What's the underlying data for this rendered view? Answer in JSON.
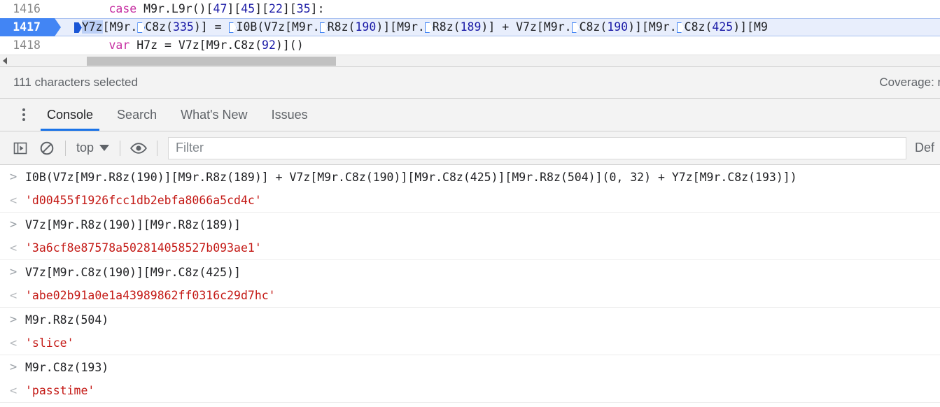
{
  "editor": {
    "lines": [
      {
        "number": "1416",
        "active": false,
        "text": "        case M9r.L9r()[47][45][22][35]:"
      },
      {
        "number": "1417",
        "active": true,
        "text": "            Y7z[M9r.C8z(335)] = I0B(V7z[M9r.R8z(190)][M9r.R8z(189)] + V7z[M9r.C8z(190)][M9r.C8z(425)][M9"
      },
      {
        "number": "1418",
        "active": false,
        "text": "            var H7z = V7z[M9r.C8z(92)]()"
      }
    ],
    "scrollbar": {
      "name": "horizontal-scrollbar"
    }
  },
  "status_bar": {
    "selection_text": "111 characters selected",
    "coverage_text": "Coverage: n"
  },
  "drawer": {
    "more_label": "More tools",
    "tabs": [
      {
        "label": "Console",
        "active": true
      },
      {
        "label": "Search",
        "active": false
      },
      {
        "label": "What's New",
        "active": false
      },
      {
        "label": "Issues",
        "active": false
      }
    ]
  },
  "toolbar": {
    "sidebar_toggle": "show-console-sidebar",
    "clear_console": "clear-console",
    "context_label": "top",
    "eye_label": "live-expressions",
    "filter_placeholder": "Filter",
    "levels_label": "Def"
  },
  "console": {
    "entries": [
      {
        "type": "command",
        "text": "I0B(V7z[M9r.R8z(190)][M9r.R8z(189)] + V7z[M9r.C8z(190)][M9r.C8z(425)][M9r.R8z(504)](0, 32) + Y7z[M9r.C8z(193)])"
      },
      {
        "type": "result",
        "text": "'d00455f1926fcc1db2ebfa8066a5cd4c'"
      },
      {
        "type": "command",
        "text": "V7z[M9r.R8z(190)][M9r.R8z(189)]"
      },
      {
        "type": "result",
        "text": "'3a6cf8e87578a502814058527b093ae1'"
      },
      {
        "type": "command",
        "text": "V7z[M9r.C8z(190)][M9r.C8z(425)]"
      },
      {
        "type": "result",
        "text": "'abe02b91a0e1a43989862ff0316c29d7hc'"
      },
      {
        "type": "command",
        "text": "M9r.R8z(504)"
      },
      {
        "type": "result",
        "text": "'slice'"
      },
      {
        "type": "command",
        "text": "M9r.C8z(193)"
      },
      {
        "type": "result",
        "text": "'passtime'"
      }
    ],
    "prompt_in": ">",
    "prompt_out": "<"
  },
  "colors": {
    "accent": "#1a73e8",
    "active_line": "#4285f4",
    "result_text": "#c41a16",
    "keyword": "#c62ea1",
    "number": "#1a1aa6"
  }
}
